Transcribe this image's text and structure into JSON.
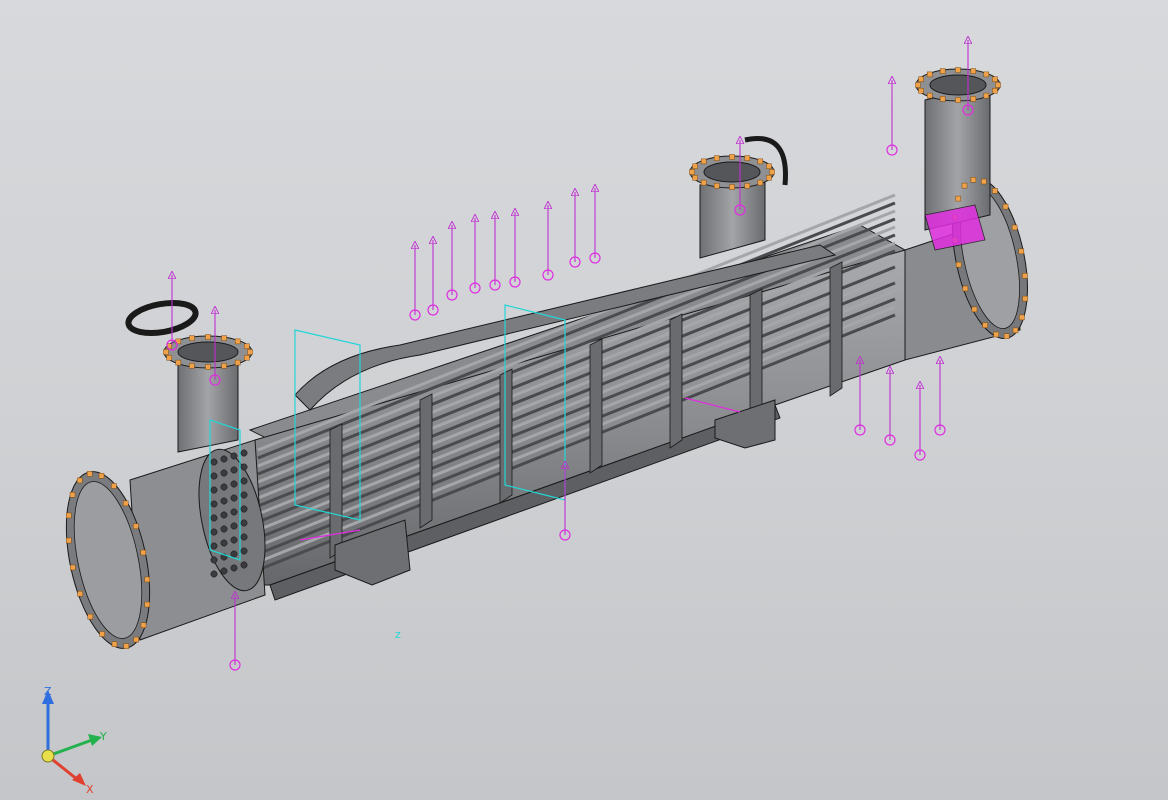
{
  "viewport": {
    "background_top": "#d7d9dc",
    "background_bottom": "#c4c6c9"
  },
  "colors": {
    "shell_light": "#9a9b9e",
    "shell_mid": "#7d7e81",
    "shell_dark": "#5e5f62",
    "edge": "#1a1a1a",
    "flange_bolt": "#f0a24a",
    "constraint": "#e02ee0",
    "section_plane": "#23d6d6"
  },
  "triad": {
    "z_label": "Z",
    "y_label": "Y",
    "x_label": "X",
    "z_color": "#2f6fe0",
    "y_color": "#22b14c",
    "x_color": "#e0402f",
    "origin_color": "#e8e04a"
  },
  "scene_marks": {
    "section_z_label": "z"
  }
}
